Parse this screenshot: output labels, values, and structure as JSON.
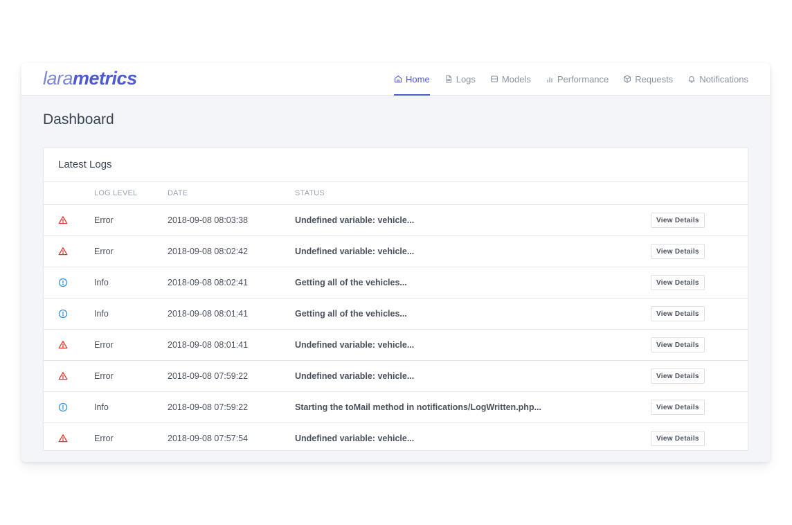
{
  "brand": {
    "part1": "lara",
    "part2": "metrics"
  },
  "nav": [
    {
      "label": "Home",
      "icon": "home-icon",
      "active": true
    },
    {
      "label": "Logs",
      "icon": "file-icon",
      "active": false
    },
    {
      "label": "Models",
      "icon": "database-icon",
      "active": false
    },
    {
      "label": "Performance",
      "icon": "bar-chart-icon",
      "active": false
    },
    {
      "label": "Requests",
      "icon": "box-icon",
      "active": false
    },
    {
      "label": "Notifications",
      "icon": "bell-icon",
      "active": false
    }
  ],
  "page": {
    "title": "Dashboard"
  },
  "logs_card": {
    "title": "Latest Logs",
    "columns": {
      "level": "LOG LEVEL",
      "date": "DATE",
      "status": "STATUS"
    },
    "action_label": "View Details",
    "rows": [
      {
        "level": "Error",
        "icon": "alert-triangle-icon",
        "date": "2018-09-08 08:03:38",
        "status": "Undefined variable: vehicle..."
      },
      {
        "level": "Error",
        "icon": "alert-triangle-icon",
        "date": "2018-09-08 08:02:42",
        "status": "Undefined variable: vehicle..."
      },
      {
        "level": "Info",
        "icon": "info-circle-icon",
        "date": "2018-09-08 08:02:41",
        "status": "Getting all of the vehicles..."
      },
      {
        "level": "Info",
        "icon": "info-circle-icon",
        "date": "2018-09-08 08:01:41",
        "status": "Getting all of the vehicles..."
      },
      {
        "level": "Error",
        "icon": "alert-triangle-icon",
        "date": "2018-09-08 08:01:41",
        "status": "Undefined variable: vehicle..."
      },
      {
        "level": "Error",
        "icon": "alert-triangle-icon",
        "date": "2018-09-08 07:59:22",
        "status": "Undefined variable: vehicle..."
      },
      {
        "level": "Info",
        "icon": "info-circle-icon",
        "date": "2018-09-08 07:59:22",
        "status": "Starting the toMail method in notifications/LogWritten.php..."
      },
      {
        "level": "Error",
        "icon": "alert-triangle-icon",
        "date": "2018-09-08 07:57:54",
        "status": "Undefined variable: vehicle..."
      }
    ]
  },
  "colors": {
    "accent": "#4e5ad0",
    "error": "#e3342f",
    "info": "#3490dc",
    "muted": "#8a94a3"
  }
}
